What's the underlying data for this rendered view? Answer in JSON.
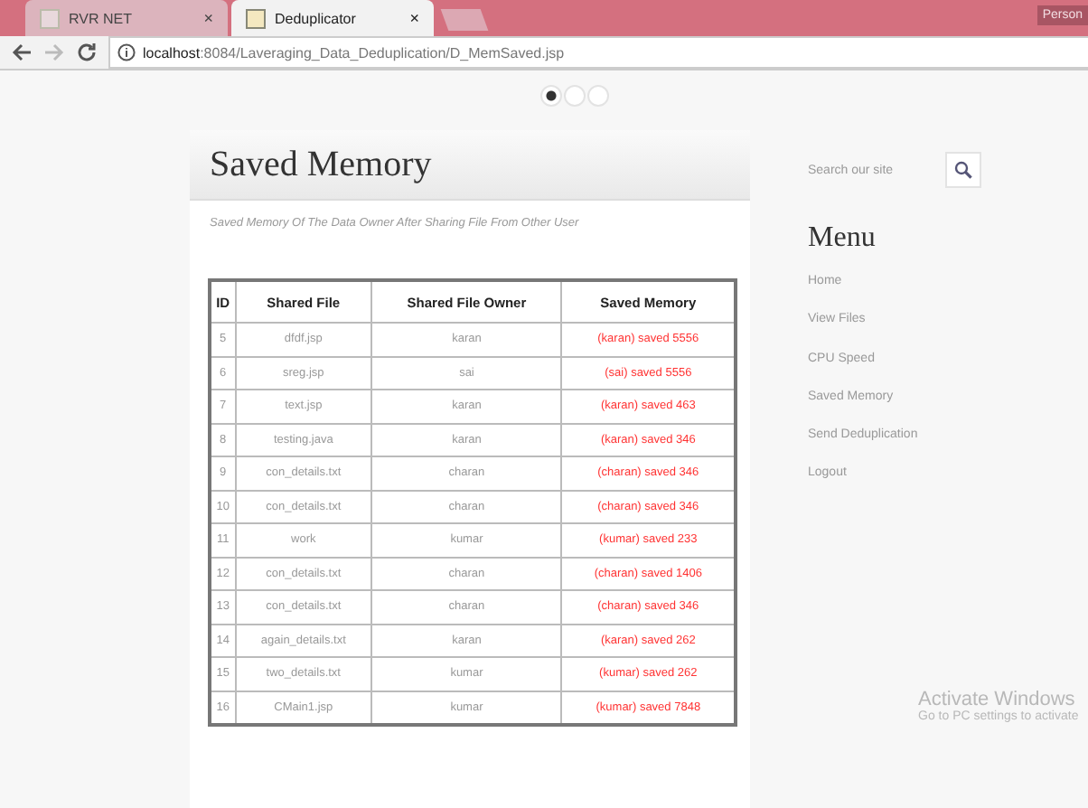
{
  "browser": {
    "tabs": [
      {
        "title": "RVR NET",
        "selected": false,
        "close": "×"
      },
      {
        "title": "Deduplicator",
        "selected": true,
        "close": "×"
      }
    ],
    "profile": "Person",
    "url_host": "localhost",
    "url_path": ":8084/Laveraging_Data_Deduplication/D_MemSaved.jsp"
  },
  "slider_dots": [
    {
      "selected": true
    },
    {
      "selected": false
    },
    {
      "selected": false
    }
  ],
  "main": {
    "title": "Saved Memory",
    "subtitle": "Saved Memory Of The Data Owner After Sharing File From Other User",
    "table": {
      "columns": [
        "ID",
        "Shared File",
        "Shared File Owner",
        "Saved Memory"
      ],
      "rows": [
        [
          "5",
          "dfdf.jsp",
          "karan",
          "(karan) saved 5556"
        ],
        [
          "6",
          "sreg.jsp",
          "sai",
          "(sai) saved 5556"
        ],
        [
          "7",
          "text.jsp",
          "karan",
          "(karan) saved 463"
        ],
        [
          "8",
          "testing.java",
          "karan",
          "(karan) saved 346"
        ],
        [
          "9",
          "con_details.txt",
          "charan",
          "(charan) saved 346"
        ],
        [
          "10",
          "con_details.txt",
          "charan",
          "(charan) saved 346"
        ],
        [
          "11",
          "work",
          "kumar",
          "(kumar) saved 233"
        ],
        [
          "12",
          "con_details.txt",
          "charan",
          "(charan) saved 1406"
        ],
        [
          "13",
          "con_details.txt",
          "charan",
          "(charan) saved 346"
        ],
        [
          "14",
          "again_details.txt",
          "karan",
          "(karan) saved 262"
        ],
        [
          "15",
          "two_details.txt",
          "kumar",
          "(kumar) saved 262"
        ],
        [
          "16",
          "CMain1.jsp",
          "kumar",
          "(kumar) saved 7848"
        ]
      ]
    }
  },
  "sidebar": {
    "search": {
      "placeholder": "Search our site"
    },
    "menu_title": "Menu",
    "menu": [
      "Home",
      "View Files",
      "CPU Speed",
      "Saved Memory",
      "Send Deduplication",
      "Logout"
    ]
  },
  "os_notice": {
    "title": "Activate Windows",
    "text": "Go to PC settings to activate"
  }
}
